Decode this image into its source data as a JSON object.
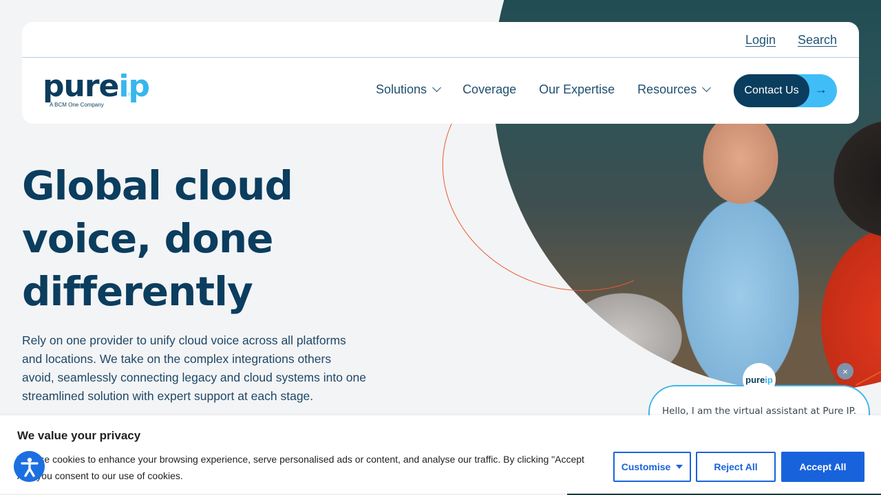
{
  "header": {
    "top_links": {
      "login": "Login",
      "search": "Search"
    },
    "logo": {
      "word_pure": "pure",
      "word_ip": "ip",
      "tm": "TM",
      "tagline": "A BCM One Company"
    },
    "nav": [
      {
        "label": "Solutions",
        "has_dropdown": true
      },
      {
        "label": "Coverage",
        "has_dropdown": false
      },
      {
        "label": "Our Expertise",
        "has_dropdown": false
      },
      {
        "label": "Resources",
        "has_dropdown": true
      }
    ],
    "cta": {
      "label": "Contact Us",
      "arrow": "→"
    }
  },
  "hero": {
    "title_lines": [
      "Global cloud",
      "voice, done",
      "differently"
    ],
    "body": "Rely on one provider to unify cloud voice across all platforms and locations. We take on the complex integrations others avoid, seamlessly connecting legacy and cloud systems into one streamlined solution with expert support at each stage."
  },
  "chat": {
    "avatar_pure": "pure",
    "avatar_ip": "ip",
    "close": "×",
    "message": "Hello, I am the virtual assistant at Pure IP."
  },
  "cookie": {
    "title": "We value your privacy",
    "text": "We use cookies to enhance your browsing experience, serve personalised ads or content, and analyse our traffic. By clicking \"Accept All\", you consent to our use of cookies.",
    "buttons": {
      "customise": "Customise",
      "reject": "Reject All",
      "accept": "Accept All"
    }
  },
  "colors": {
    "brand_navy": "#0b3d5e",
    "brand_cyan": "#37b6ef",
    "cookie_blue": "#1863dc",
    "accent_orange": "#e8582e"
  }
}
